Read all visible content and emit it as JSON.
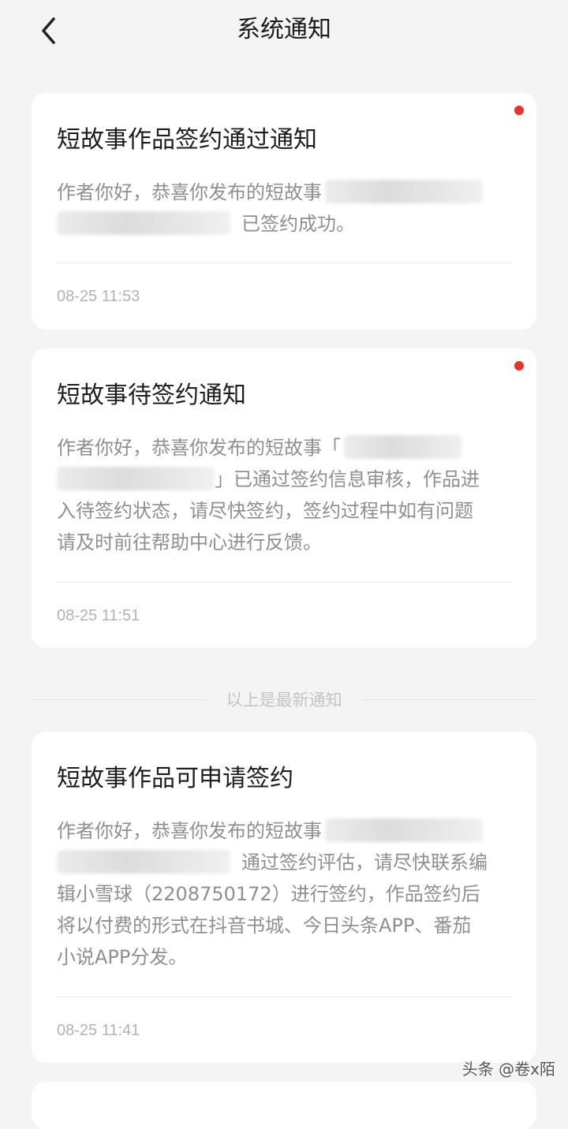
{
  "header": {
    "title": "系统通知",
    "back_icon": "chevron-left-icon"
  },
  "notifications": [
    {
      "title": "短故事作品签约通过通知",
      "body_line1": "作者你好，恭喜你发布的短故事",
      "body_line2": "已签约成功。",
      "time": "08-25 11:53",
      "unread": true
    },
    {
      "title": "短故事待签约通知",
      "body_line1": "作者你好，恭喜你发布的短故事「",
      "body_line2": "」已通过签约信息审核，作品进",
      "body_line3": "入待签约状态，请尽快签约，签约过程中如有问题",
      "body_line4": "请及时前往帮助中心进行反馈。",
      "time": "08-25 11:51",
      "unread": true
    },
    {
      "title": "短故事作品可申请签约",
      "body_line1": "作者你好，恭喜你发布的短故事",
      "body_line2": "通过签约评估，请尽快联系编",
      "body_line3": "辑小雪球（2208750172）进行签约，作品签约后",
      "body_line4": "将以付费的形式在抖音书城、今日头条APP、番茄",
      "body_line5": "小说APP分发。",
      "time": "08-25 11:41",
      "unread": false
    }
  ],
  "separator": {
    "text": "以上是最新通知"
  },
  "watermark": {
    "text": "头条 @卷x陌"
  },
  "colors": {
    "background": "#f4f4f4",
    "card": "#ffffff",
    "unread_dot": "#e8322b",
    "body_text": "#8f8f8f",
    "time_text": "#b3b3b3"
  }
}
